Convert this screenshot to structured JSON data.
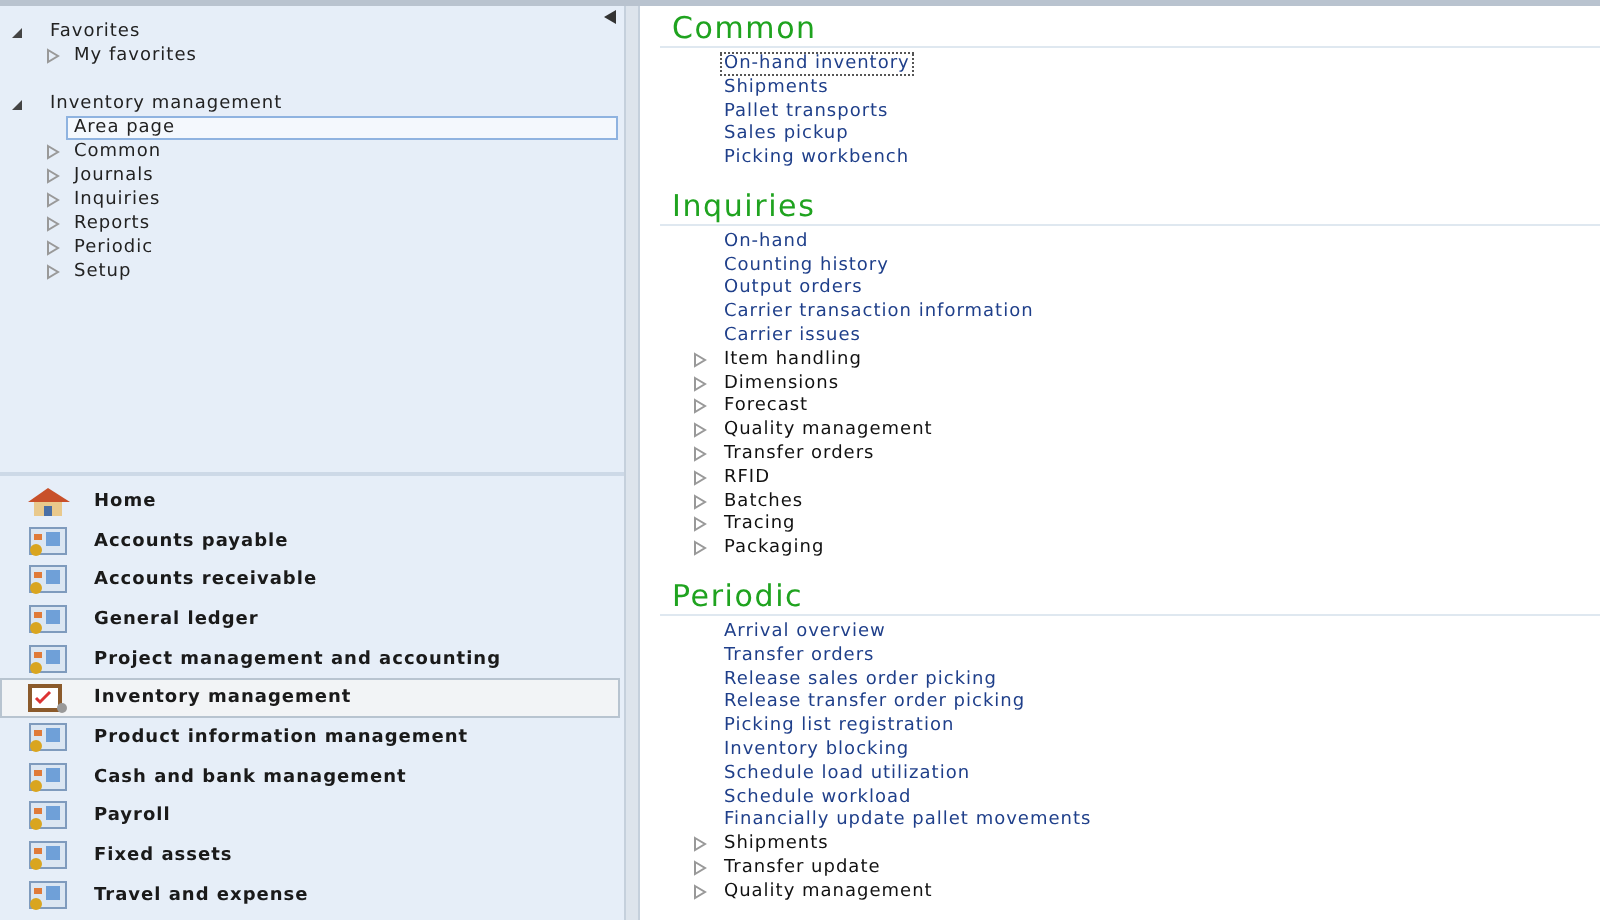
{
  "navigation_tree": [
    {
      "label": "Favorites",
      "expanded": true,
      "children": [
        {
          "label": "My favorites",
          "kind": "folder",
          "selected": false
        }
      ]
    },
    {
      "label": "Inventory management",
      "expanded": true,
      "children": [
        {
          "label": "Area page",
          "kind": "leaf",
          "selected": true
        },
        {
          "label": "Common",
          "kind": "folder",
          "selected": false
        },
        {
          "label": "Journals",
          "kind": "folder",
          "selected": false
        },
        {
          "label": "Inquiries",
          "kind": "folder",
          "selected": false
        },
        {
          "label": "Reports",
          "kind": "folder",
          "selected": false
        },
        {
          "label": "Periodic",
          "kind": "folder",
          "selected": false
        },
        {
          "label": "Setup",
          "kind": "folder",
          "selected": false
        }
      ]
    }
  ],
  "modules": [
    {
      "label": "Home",
      "selected": false
    },
    {
      "label": "Accounts payable",
      "selected": false
    },
    {
      "label": "Accounts receivable",
      "selected": false
    },
    {
      "label": "General ledger",
      "selected": false
    },
    {
      "label": "Project management and accounting",
      "selected": false
    },
    {
      "label": "Inventory management",
      "selected": true
    },
    {
      "label": "Product information management",
      "selected": false
    },
    {
      "label": "Cash and bank management",
      "selected": false
    },
    {
      "label": "Payroll",
      "selected": false
    },
    {
      "label": "Fixed assets",
      "selected": false
    },
    {
      "label": "Travel and expense",
      "selected": false
    }
  ],
  "sections": [
    {
      "title": "Common",
      "items": [
        {
          "label": "On-hand inventory",
          "kind": "link",
          "focused": true
        },
        {
          "label": "Shipments",
          "kind": "link",
          "focused": false
        },
        {
          "label": "Pallet transports",
          "kind": "link",
          "focused": false
        },
        {
          "label": "Sales pickup",
          "kind": "link",
          "focused": false
        },
        {
          "label": "Picking workbench",
          "kind": "link",
          "focused": false
        }
      ]
    },
    {
      "title": "Inquiries",
      "items": [
        {
          "label": "On-hand",
          "kind": "link",
          "focused": false
        },
        {
          "label": "Counting history",
          "kind": "link",
          "focused": false
        },
        {
          "label": "Output orders",
          "kind": "link",
          "focused": false
        },
        {
          "label": "Carrier transaction information",
          "kind": "link",
          "focused": false
        },
        {
          "label": "Carrier issues",
          "kind": "link",
          "focused": false
        },
        {
          "label": "Item handling",
          "kind": "group",
          "focused": false
        },
        {
          "label": "Dimensions",
          "kind": "group",
          "focused": false
        },
        {
          "label": "Forecast",
          "kind": "group",
          "focused": false
        },
        {
          "label": "Quality management",
          "kind": "group",
          "focused": false
        },
        {
          "label": "Transfer orders",
          "kind": "group",
          "focused": false
        },
        {
          "label": "RFID",
          "kind": "group",
          "focused": false
        },
        {
          "label": "Batches",
          "kind": "group",
          "focused": false
        },
        {
          "label": "Tracing",
          "kind": "group",
          "focused": false
        },
        {
          "label": "Packaging",
          "kind": "group",
          "focused": false
        }
      ]
    },
    {
      "title": "Periodic",
      "items": [
        {
          "label": "Arrival overview",
          "kind": "link",
          "focused": false
        },
        {
          "label": "Transfer orders",
          "kind": "link",
          "focused": false
        },
        {
          "label": "Release sales order picking",
          "kind": "link",
          "focused": false
        },
        {
          "label": "Release transfer order picking",
          "kind": "link",
          "focused": false
        },
        {
          "label": "Picking list registration",
          "kind": "link",
          "focused": false
        },
        {
          "label": "Inventory blocking",
          "kind": "link",
          "focused": false
        },
        {
          "label": "Schedule load utilization",
          "kind": "link",
          "focused": false
        },
        {
          "label": "Schedule workload",
          "kind": "link",
          "focused": false
        },
        {
          "label": "Financially update pallet movements",
          "kind": "link",
          "focused": false
        },
        {
          "label": "Shipments",
          "kind": "group",
          "focused": false
        },
        {
          "label": "Transfer update",
          "kind": "group",
          "focused": false
        },
        {
          "label": "Quality management",
          "kind": "group",
          "focused": false
        }
      ]
    }
  ]
}
